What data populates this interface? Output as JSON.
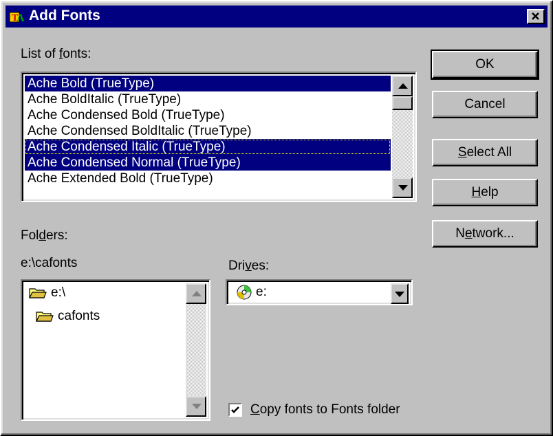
{
  "window": {
    "title": "Add Fonts",
    "app_icon": "fonts-folder-icon",
    "close_icon": "close-icon"
  },
  "fonts_list": {
    "label_pre": "List of ",
    "label_accel": "f",
    "label_post": "onts:",
    "items": [
      {
        "text": "Ache Bold (TrueType)",
        "selected": true,
        "focused": false
      },
      {
        "text": "Ache BoldItalic (TrueType)",
        "selected": false,
        "focused": false
      },
      {
        "text": "Ache Condensed Bold (TrueType)",
        "selected": false,
        "focused": false
      },
      {
        "text": "Ache Condensed BoldItalic (TrueType)",
        "selected": false,
        "focused": false
      },
      {
        "text": "Ache Condensed Italic (TrueType)",
        "selected": true,
        "focused": true
      },
      {
        "text": "Ache Condensed Normal (TrueType)",
        "selected": true,
        "focused": false
      },
      {
        "text": "Ache Extended Bold (TrueType)",
        "selected": false,
        "focused": false
      }
    ]
  },
  "folders": {
    "label_pre": "Fol",
    "label_accel": "d",
    "label_post": "ers:",
    "current_path": "e:\\cafonts",
    "tree": [
      "e:\\",
      "cafonts"
    ]
  },
  "drives": {
    "label_pre": "Dri",
    "label_accel": "v",
    "label_post": "es:",
    "selected": "e:",
    "drive_icon": "cd-drive-icon"
  },
  "buttons": {
    "ok": {
      "pre": "OK",
      "accel": "",
      "post": ""
    },
    "cancel": {
      "pre": "Cancel",
      "accel": "",
      "post": ""
    },
    "select_all": {
      "pre": "",
      "accel": "S",
      "post": "elect All"
    },
    "help": {
      "pre": "",
      "accel": "H",
      "post": "elp"
    },
    "network": {
      "pre": "N",
      "accel": "e",
      "post": "twork..."
    }
  },
  "copy_fonts": {
    "checked": true,
    "pre": "",
    "accel": "C",
    "post": "opy fonts to Fonts folder"
  },
  "colors": {
    "face": "#c0c0c0",
    "titlebar": "#000080",
    "selection": "#000080",
    "window": "#ffffff"
  }
}
